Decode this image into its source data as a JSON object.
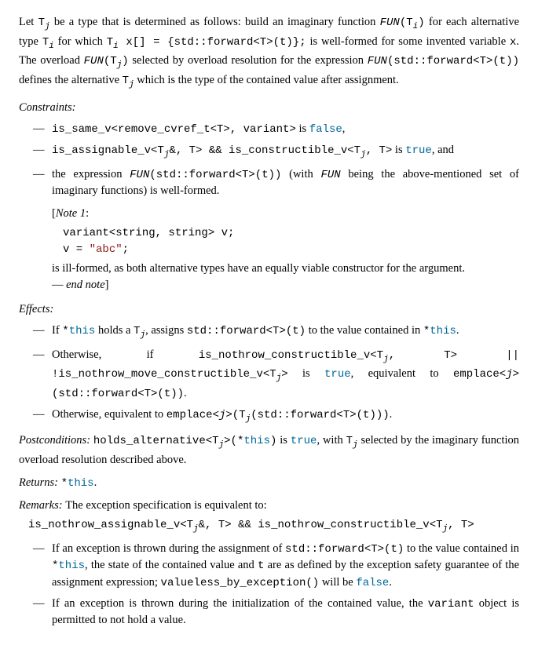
{
  "intro": {
    "p1_a": "Let ",
    "p1_b": " be a type that is determined as follows: build an imaginary function ",
    "p1_c": " for each alternative type ",
    "p1_d": " for which ",
    "p1_e": " is well-formed for some invented variable ",
    "p1_f": ". The overload ",
    "p1_g": " selected by overload resolution for the expression ",
    "p1_h": " defines the alternative ",
    "p1_i": " which is the type of the contained value after assignment.",
    "Tj": "T",
    "j": "j",
    "Ti": "T",
    "i": "i",
    "fun_ti": "FUN",
    "fun_ti_paren_l": "(",
    "fun_ti_paren_r": ")",
    "decl": " x[] = {std::forward<T>(t)};",
    "x": "x",
    "fun_tj_l": "FUN",
    "fun_fwd": "(std::forward<T>(t))"
  },
  "constraints": {
    "label": "Constraints:",
    "c1_a": "is_same_v<remove_cvref_t<T>, variant>",
    "c1_b": " is ",
    "c1_false": "false",
    "c1_c": ",",
    "c2_a": "is_assignable_v<T",
    "c2_amp": "&, T> && is_constructible_v<T",
    "c2_end": ", T>",
    "c2_b": " is ",
    "c2_true": "true",
    "c2_c": ", and",
    "c3_a": "the expression ",
    "c3_fun": "FUN",
    "c3_fwd": "(std::forward<T>(t))",
    "c3_b": " (with ",
    "c3_c": " being the above-mentioned set of imaginary functions) is well-formed.",
    "note_label": "Note 1",
    "note_code1": "variant<string, string> v;",
    "note_code2": "v = ",
    "note_str": "\"abc\"",
    "note_semi": ";",
    "note_text": "is ill-formed, as both alternative types have an equally viable constructor for the argument.",
    "note_end": "end note"
  },
  "effects": {
    "label": "Effects:",
    "e1_a": "If ",
    "e1_this": "*",
    "e1_this2": "this",
    "e1_b": " holds a ",
    "e1_c": ", assigns ",
    "e1_fwd": "std::forward<T>(t)",
    "e1_d": " to the value contained in ",
    "e1_e": ".",
    "e2_a": "Otherwise, if ",
    "e2_code1": "is_nothrow_constructible_v<T",
    "e2_code1b": ", T> || !is_nothrow_move_constructible_v<T",
    "e2_code1c": ">",
    "e2_b": " is ",
    "e2_true": "true",
    "e2_c": ", equivalent to ",
    "e2_emp": "emplace<",
    "e2_emp2": ">(std::forward<T>(t))",
    "e2_d": ".",
    "e3_a": "Otherwise, equivalent to ",
    "e3_emp": "emplace<",
    "e3_emp2": ">(T",
    "e3_emp3": "(std::forward<T>(t)))",
    "e3_b": "."
  },
  "postcond": {
    "label": "Postconditions: ",
    "code": "holds_alternative<T",
    "code2": ">(*",
    "code_this": "this",
    "code3": ")",
    "a": " is ",
    "true": "true",
    "b": ", with ",
    "c": " selected by the imaginary function overload resolution described above."
  },
  "returns": {
    "label": "Returns: ",
    "star": "*",
    "this": "this",
    "dot": "."
  },
  "remarks": {
    "label": "Remarks: ",
    "text": "The exception specification is equivalent to:",
    "spec1": "is_nothrow_assignable_v<T",
    "spec1b": "&, T> && is_nothrow_constructible_v<T",
    "spec1c": ", T>",
    "r1_a": "If an exception is thrown during the assignment of ",
    "r1_fwd": "std::forward<T>(t)",
    "r1_b": " to the value contained in ",
    "r1_this": "this",
    "r1_c": ", the state of the contained value and ",
    "r1_t": "t",
    "r1_d": " are as defined by the exception safety guarantee of the assignment expression; ",
    "r1_vbex": "valueless_by_exception()",
    "r1_e": " will be ",
    "r1_false": "false",
    "r1_f": ".",
    "r2_a": "If an exception is thrown during the initialization of the contained value, the ",
    "r2_var": "variant",
    "r2_b": " object is permitted to not hold a value."
  }
}
